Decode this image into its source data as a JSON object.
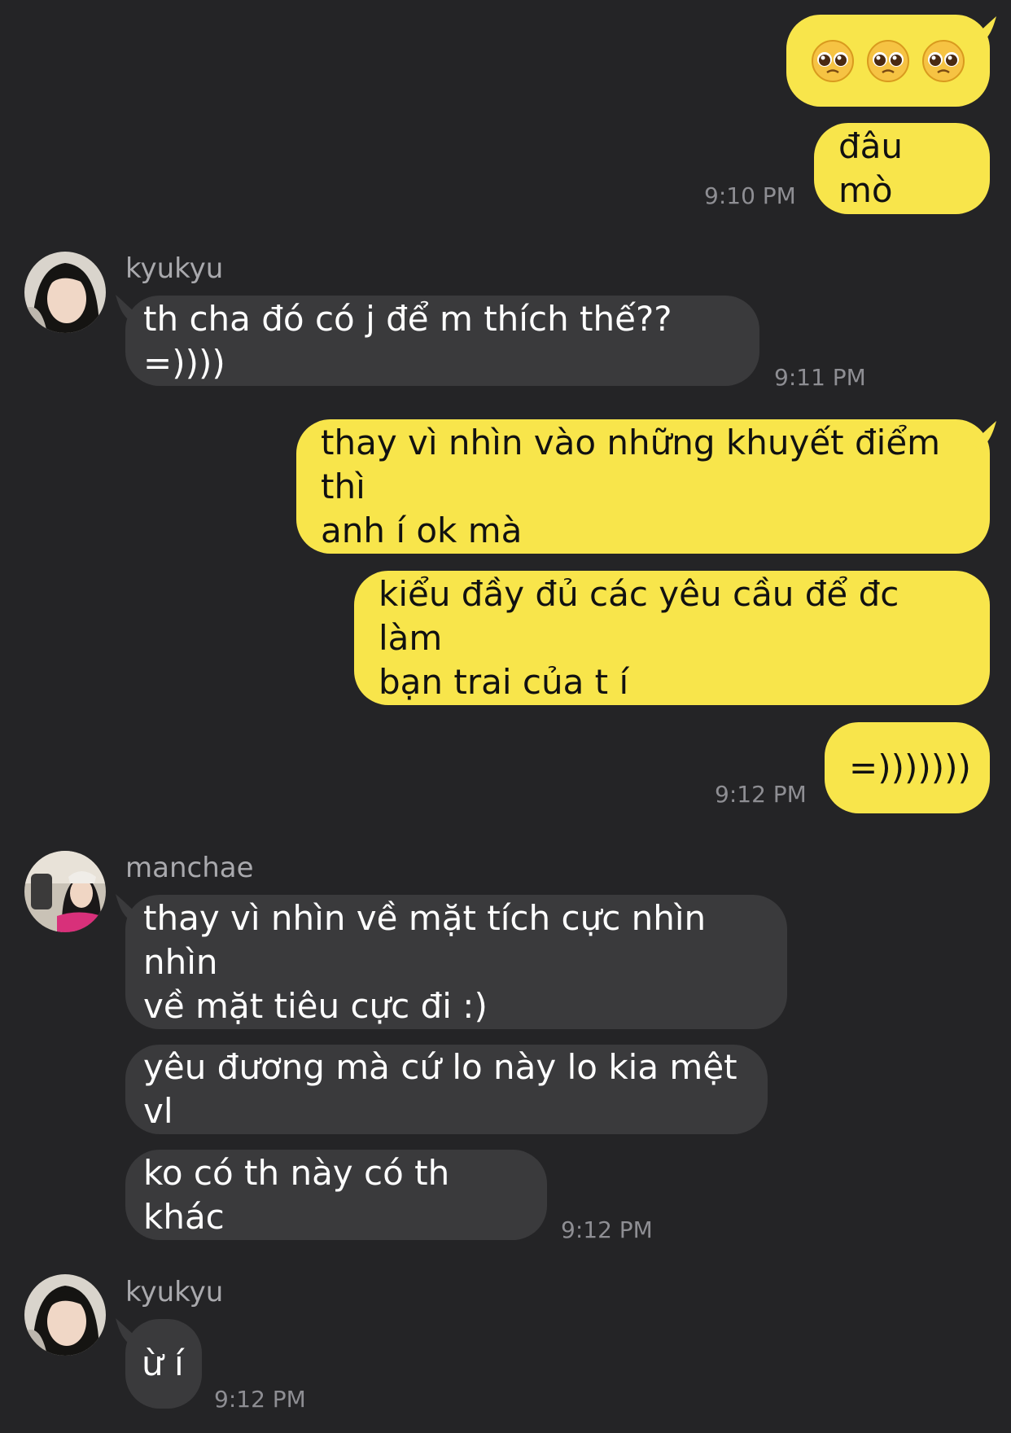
{
  "messages": {
    "m1": {
      "emoji": [
        "pleading-face-emoji",
        "pleading-face-emoji",
        "pleading-face-emoji"
      ]
    },
    "m2": {
      "text": "đâu mò",
      "time": "9:10 PM"
    },
    "m3": {
      "sender": "kyukyu",
      "text": "th cha đó có j để m thích thế?? =))))",
      "time": "9:11 PM"
    },
    "m4": {
      "text": "thay vì nhìn vào những khuyết điểm thì\nanh í ok mà"
    },
    "m5": {
      "text": "kiểu đầy đủ các yêu cầu để đc làm\nbạn trai của t í"
    },
    "m6": {
      "text": "=)))))))",
      "time": "9:12 PM"
    },
    "m7": {
      "sender": "manchae",
      "text": "thay vì nhìn về mặt tích cực nhìn nhìn\nvề mặt tiêu cực đi :)"
    },
    "m8": {
      "text": "yêu đương mà cứ lo này lo kia mệt vl"
    },
    "m9": {
      "text": "ko có th này có th khác",
      "time": "9:12 PM"
    },
    "m10": {
      "sender": "kyukyu",
      "text": "ừ í",
      "time": "9:12 PM"
    }
  },
  "colors": {
    "background": "#242426",
    "outgoing_bubble": "#f8e54b",
    "incoming_bubble": "#3a3a3c",
    "timestamp": "#8e8e93",
    "sender_name": "#a9a9ad"
  }
}
